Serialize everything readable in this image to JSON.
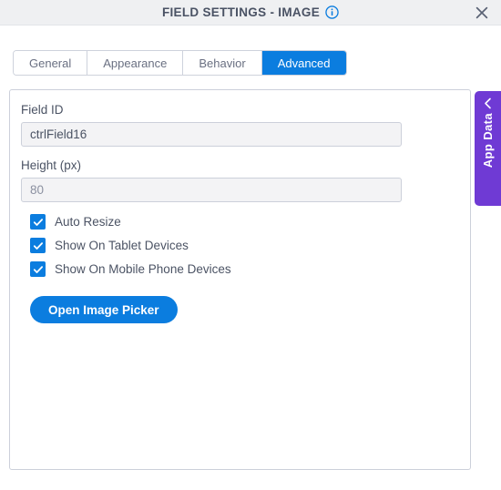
{
  "header": {
    "title": "FIELD SETTINGS - IMAGE",
    "info_icon": "info-circle-icon",
    "close_icon": "close-icon",
    "accent_color": "#0b7ddf",
    "background": "#eff0f2"
  },
  "tabs": [
    {
      "label": "General",
      "active": false
    },
    {
      "label": "Appearance",
      "active": false
    },
    {
      "label": "Behavior",
      "active": false
    },
    {
      "label": "Advanced",
      "active": true
    }
  ],
  "form": {
    "field_id": {
      "label": "Field ID",
      "value": "ctrlField16",
      "placeholder": ""
    },
    "height": {
      "label": "Height (px)",
      "value": "",
      "placeholder": "80"
    },
    "checkboxes": [
      {
        "label": "Auto Resize",
        "checked": true
      },
      {
        "label": "Show On Tablet Devices",
        "checked": true
      },
      {
        "label": "Show On Mobile Phone Devices",
        "checked": true
      }
    ],
    "image_picker_button": "Open Image Picker"
  },
  "side_panel": {
    "label": "App Data",
    "chevron_icon": "chevron-left-icon",
    "color": "#6f3ad4"
  }
}
